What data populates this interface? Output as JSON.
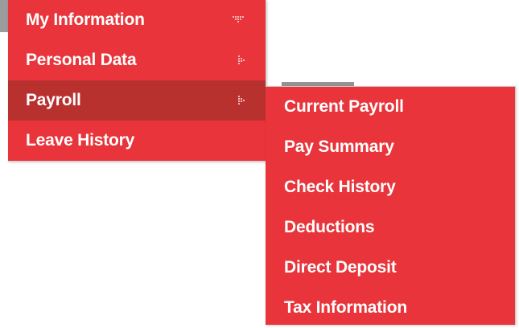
{
  "colors": {
    "menu_bg": "#e8343a",
    "active_bg": "#b8312f",
    "text": "#ffffff",
    "border": "#cdcdcd"
  },
  "menu": {
    "items": [
      {
        "label": "My Information",
        "icon": "chevron-down-icon"
      },
      {
        "label": "Personal Data",
        "icon": "chevron-right-icon"
      },
      {
        "label": "Payroll",
        "icon": "chevron-right-icon",
        "active": true
      },
      {
        "label": "Leave History"
      }
    ]
  },
  "submenu": {
    "parent": "Payroll",
    "items": [
      {
        "label": "Current Payroll"
      },
      {
        "label": "Pay Summary"
      },
      {
        "label": "Check History"
      },
      {
        "label": "Deductions"
      },
      {
        "label": "Direct Deposit"
      },
      {
        "label": "Tax Information"
      }
    ]
  }
}
